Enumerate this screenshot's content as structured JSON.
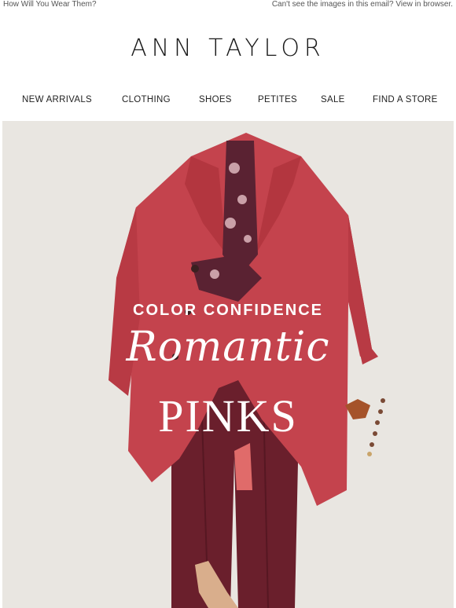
{
  "preheader": {
    "left_text": "How Will You Wear Them?",
    "right_text": "Can't see the images in this email? View in browser."
  },
  "brand": {
    "logo_text": "ANN TAYLOR"
  },
  "nav": {
    "items": [
      {
        "label": "NEW ARRIVALS"
      },
      {
        "label": "CLOTHING"
      },
      {
        "label": "SHOES"
      },
      {
        "label": "PETITES"
      },
      {
        "label": "SALE"
      },
      {
        "label": "FIND A STORE"
      }
    ]
  },
  "hero": {
    "kicker": "COLOR CONFIDENCE",
    "script": "Romantic",
    "title": "PINKS",
    "colors": {
      "background": "#e9e6e1",
      "coat": "#c4434d",
      "pants": "#6a1f2c",
      "blouse": "#5a2232",
      "shoe": "#d9ae8c",
      "text": "#ffffff"
    }
  }
}
